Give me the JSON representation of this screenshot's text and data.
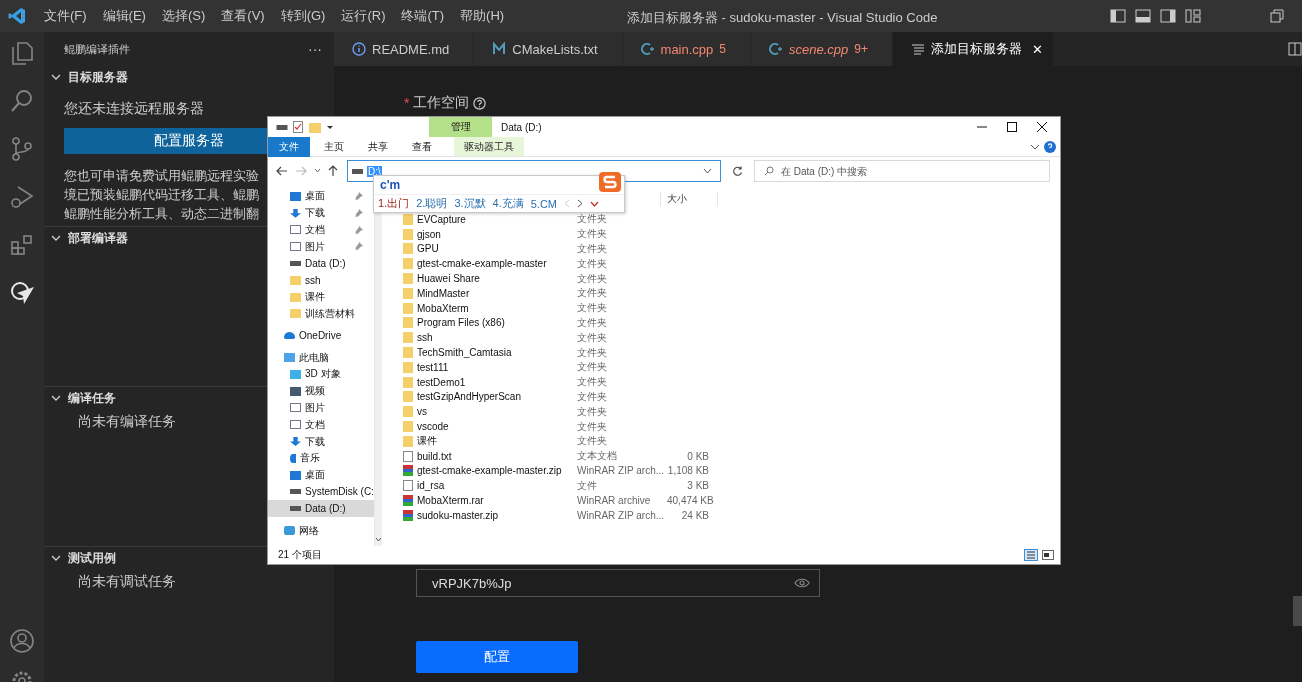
{
  "titlebar": {
    "menus": [
      "文件(F)",
      "编辑(E)",
      "选择(S)",
      "查看(V)",
      "转到(G)",
      "运行(R)",
      "终端(T)",
      "帮助(H)"
    ],
    "title": "添加目标服务器 - sudoku-master - Visual Studio Code"
  },
  "sidebar": {
    "title": "鲲鹏编译插件",
    "more": "···",
    "sections": [
      {
        "title": "目标服务器",
        "expanded": true,
        "status": "您还未连接远程服务器",
        "button": "配置服务器",
        "lines": [
          "您也可申请免费试用鲲鹏远程实验",
          "境已预装鲲鹏代码迁移工具、鲲鹏",
          "鲲鹏性能分析工具、动态二进制翻"
        ]
      },
      {
        "title": "部署编译器",
        "expanded": true
      },
      {
        "title": "编译任务",
        "expanded": true,
        "message": "尚未有编译任务"
      },
      {
        "title": "测试用例",
        "expanded": true,
        "message": "尚未有调试任务"
      }
    ]
  },
  "tabs": [
    {
      "label": "README.md",
      "kind": "info",
      "selected": false,
      "error": false,
      "preview": false
    },
    {
      "label": "CMakeLists.txt",
      "kind": "cmake",
      "selected": false,
      "error": false,
      "preview": false
    },
    {
      "label": "main.cpp",
      "kind": "cpp",
      "selected": false,
      "error": true,
      "preview": false,
      "badge": "5"
    },
    {
      "label": "scene.cpp",
      "kind": "cpp",
      "selected": false,
      "error": true,
      "preview": true,
      "badge": "9+"
    },
    {
      "label": "添加目标服务器",
      "kind": "webview",
      "selected": true,
      "error": false,
      "preview": false,
      "close": "✕"
    }
  ],
  "form": {
    "workspace_label": "工作空间",
    "required_mark": "*",
    "password": "vRPJK7b%Jp",
    "button": "配置"
  },
  "explorer": {
    "title": "Data (D:)",
    "context_tab": "管理",
    "ribbon_tabs": [
      {
        "label": "文件",
        "selected": true
      },
      {
        "label": "主页",
        "selected": false
      },
      {
        "label": "共享",
        "selected": false
      },
      {
        "label": "查看",
        "selected": false
      },
      {
        "label": "驱动器工具",
        "selected": false
      }
    ],
    "address": "D:\\",
    "search_placeholder": "在 Data (D:) 中搜索",
    "ime": {
      "input": "c'm",
      "candidates": [
        {
          "label": "1.出门",
          "selected": true
        },
        {
          "label": "2.聪明",
          "selected": false
        },
        {
          "label": "3.沉默",
          "selected": false
        },
        {
          "label": "4.充满",
          "selected": false
        },
        {
          "label": "5.CM",
          "selected": false
        }
      ]
    },
    "size_header": "大小",
    "nav": [
      {
        "label": "桌面",
        "kind": "desktop",
        "pinned": true,
        "selected": false
      },
      {
        "label": "下载",
        "kind": "download",
        "pinned": true,
        "selected": false
      },
      {
        "label": "文档",
        "kind": "document",
        "pinned": true,
        "selected": false
      },
      {
        "label": "图片",
        "kind": "picture",
        "pinned": true,
        "selected": false
      },
      {
        "label": "Data (D:)",
        "kind": "drive",
        "pinned": false,
        "selected": false
      },
      {
        "label": "ssh",
        "kind": "folder",
        "pinned": false,
        "selected": false
      },
      {
        "label": "课件",
        "kind": "folder",
        "pinned": false,
        "selected": false
      },
      {
        "label": "训练营材料",
        "kind": "folder",
        "pinned": false,
        "selected": false
      },
      {
        "label": "OneDrive",
        "kind": "onedrive",
        "pinned": false,
        "selected": false
      },
      {
        "label": "此电脑",
        "kind": "pc",
        "pinned": false,
        "selected": false,
        "children": [
          {
            "label": "3D 对象",
            "kind": "cube",
            "pinned": false,
            "selected": false
          },
          {
            "label": "视频",
            "kind": "video",
            "pinned": false,
            "selected": false
          },
          {
            "label": "图片",
            "kind": "picture",
            "pinned": false,
            "selected": false
          },
          {
            "label": "文档",
            "kind": "document",
            "pinned": false,
            "selected": false
          },
          {
            "label": "下载",
            "kind": "download",
            "pinned": false,
            "selected": false
          },
          {
            "label": "音乐",
            "kind": "music",
            "pinned": false,
            "selected": false
          },
          {
            "label": "桌面",
            "kind": "desktop",
            "pinned": false,
            "selected": false
          },
          {
            "label": "SystemDisk (C:",
            "kind": "drive",
            "pinned": false,
            "selected": false
          },
          {
            "label": "Data (D:)",
            "kind": "drive",
            "pinned": false,
            "selected": true
          }
        ]
      },
      {
        "label": "网络",
        "kind": "network",
        "pinned": false,
        "selected": false
      }
    ],
    "files": [
      {
        "name": "EVCapture",
        "kind": "folder",
        "type": "文件夹"
      },
      {
        "name": "gjson",
        "kind": "folder",
        "type": "文件夹"
      },
      {
        "name": "GPU",
        "kind": "folder",
        "type": "文件夹"
      },
      {
        "name": "gtest-cmake-example-master",
        "kind": "folder",
        "type": "文件夹"
      },
      {
        "name": "Huawei Share",
        "kind": "folder",
        "type": "文件夹"
      },
      {
        "name": "MindMaster",
        "kind": "folder",
        "type": "文件夹"
      },
      {
        "name": "MobaXterm",
        "kind": "folder",
        "type": "文件夹"
      },
      {
        "name": "Program Files (x86)",
        "kind": "folder",
        "type": "文件夹"
      },
      {
        "name": "ssh",
        "kind": "folder",
        "type": "文件夹"
      },
      {
        "name": "TechSmith_Camtasia",
        "kind": "folder",
        "type": "文件夹"
      },
      {
        "name": "test111",
        "kind": "folder",
        "type": "文件夹"
      },
      {
        "name": "testDemo1",
        "kind": "folder",
        "type": "文件夹"
      },
      {
        "name": "testGzipAndHyperScan",
        "kind": "folder",
        "type": "文件夹"
      },
      {
        "name": "vs",
        "kind": "folder",
        "type": "文件夹"
      },
      {
        "name": "vscode",
        "kind": "folder",
        "type": "文件夹"
      },
      {
        "name": "课件",
        "kind": "folder",
        "type": "文件夹"
      },
      {
        "name": "build.txt",
        "kind": "text",
        "type": "文本文档",
        "size": "0 KB"
      },
      {
        "name": "gtest-cmake-example-master.zip",
        "kind": "archive",
        "type": "WinRAR ZIP arch...",
        "size": "1,108 KB"
      },
      {
        "name": "id_rsa",
        "kind": "file",
        "type": "文件",
        "size": "3 KB"
      },
      {
        "name": "MobaXterm.rar",
        "kind": "archive",
        "type": "WinRAR archive",
        "size": "40,474 KB"
      },
      {
        "name": "sudoku-master.zip",
        "kind": "archive",
        "type": "WinRAR ZIP arch...",
        "size": "24 KB"
      }
    ],
    "status": "21 个项目"
  }
}
